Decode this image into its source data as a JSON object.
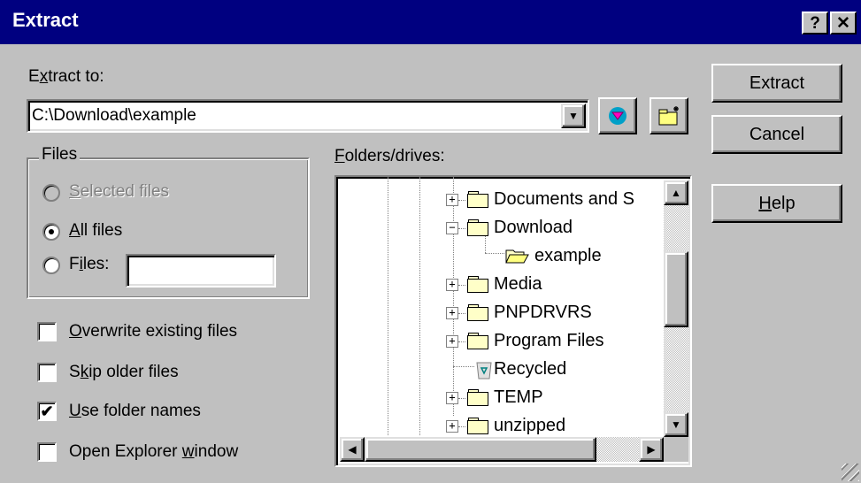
{
  "window": {
    "title": "Extract",
    "help_glyph": "?",
    "close_glyph": "✕"
  },
  "extract_to": {
    "label_pre": "E",
    "label_u": "x",
    "label_post": "tract to:",
    "value": "C:\\Download\\example"
  },
  "files_group": {
    "legend": "Files",
    "options": [
      {
        "pre": "",
        "u": "S",
        "post": "elected files",
        "selected": false,
        "disabled": true
      },
      {
        "pre": "",
        "u": "A",
        "post": "ll files",
        "selected": true,
        "disabled": false
      },
      {
        "pre": "F",
        "u": "i",
        "post": "les:",
        "selected": false,
        "disabled": false
      }
    ],
    "files_input_value": ""
  },
  "checkboxes": [
    {
      "pre": "",
      "u": "O",
      "post": "verwrite existing files",
      "checked": false
    },
    {
      "pre": "S",
      "u": "k",
      "post": "ip older files",
      "checked": false
    },
    {
      "pre": "",
      "u": "U",
      "post": "se folder names",
      "checked": true
    },
    {
      "pre": "Open Explorer ",
      "u": "w",
      "post": "indow",
      "checked": false
    }
  ],
  "folders": {
    "label_u": "F",
    "label_post": "olders/drives:",
    "items": [
      {
        "label": "Documents and S",
        "expander": "+",
        "icon": "folder-icon"
      },
      {
        "label": "Download",
        "expander": "−",
        "icon": "folder-icon"
      },
      {
        "label": "example",
        "expander": "",
        "icon": "open-folder-icon"
      },
      {
        "label": "Media",
        "expander": "+",
        "icon": "folder-icon"
      },
      {
        "label": "PNPDRVRS",
        "expander": "+",
        "icon": "folder-icon"
      },
      {
        "label": "Program Files",
        "expander": "+",
        "icon": "folder-icon"
      },
      {
        "label": "Recycled",
        "expander": "",
        "icon": "recycle-bin-icon"
      },
      {
        "label": "TEMP",
        "expander": "+",
        "icon": "folder-icon"
      },
      {
        "label": "unzipped",
        "expander": "+",
        "icon": "folder-icon"
      }
    ]
  },
  "buttons": {
    "extract": "Extract",
    "cancel": "Cancel",
    "help_u": "H",
    "help_post": "elp"
  },
  "glyphs": {
    "dropdown": "▼",
    "up": "▲",
    "down": "▼",
    "left": "◀",
    "right": "▶",
    "check": "✔"
  }
}
